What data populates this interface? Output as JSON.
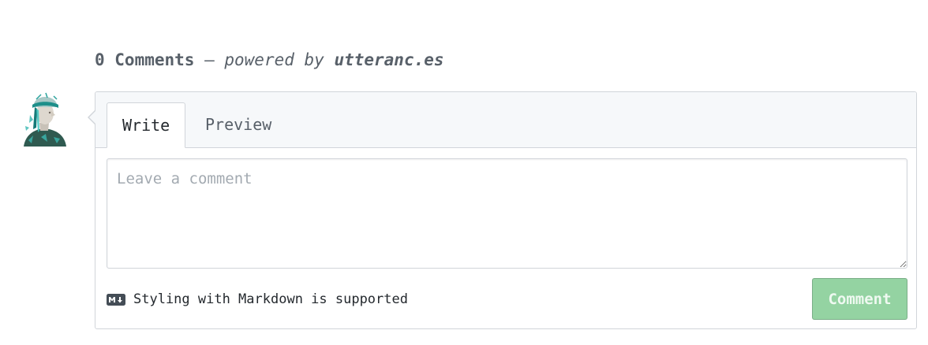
{
  "header": {
    "count_label": "0 Comments",
    "separator": " – ",
    "powered_by": "powered by ",
    "brand_link": "utteranc.es"
  },
  "editor": {
    "tabs": [
      {
        "label": "Write",
        "selected": true
      },
      {
        "label": "Preview",
        "selected": false
      }
    ],
    "textarea": {
      "value": "",
      "placeholder": "Leave a comment"
    },
    "markdown_note": "Styling with Markdown is supported",
    "submit_label": "Comment"
  },
  "colors": {
    "button_disabled_green": "#94d3a2",
    "tab_bar_bg": "#f6f8fa",
    "border": "#d1d5da"
  },
  "icons": {
    "avatar": "user-avatar",
    "markdown": "markdown-icon"
  }
}
